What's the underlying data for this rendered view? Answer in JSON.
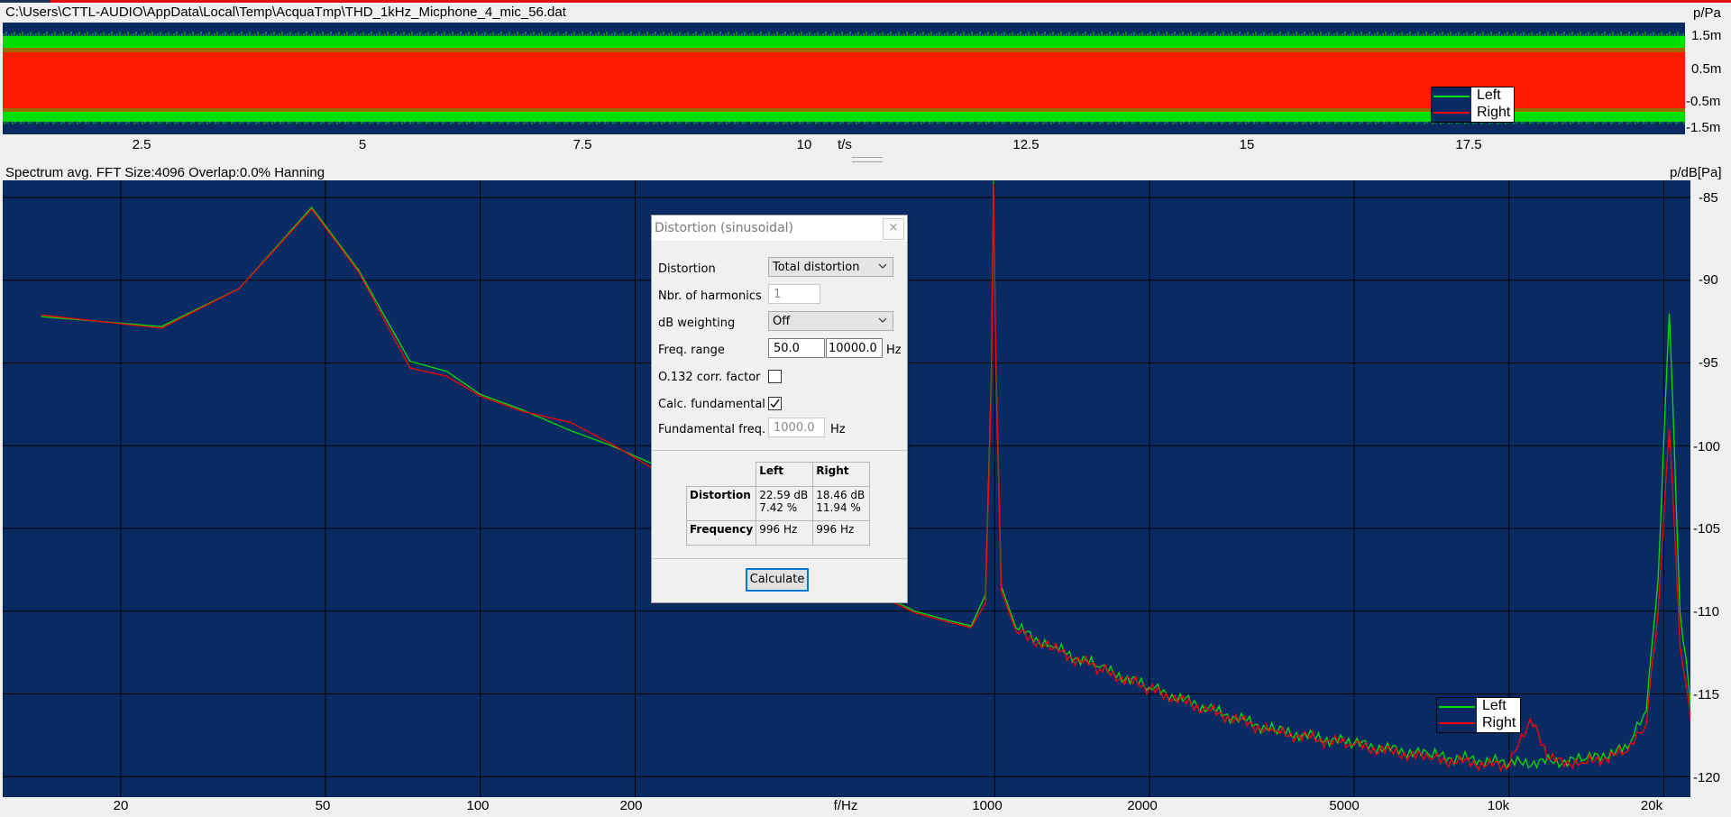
{
  "colors": {
    "plot_bg": "#0a2a63",
    "left": "#00e000",
    "right": "#ff0000",
    "grid": "#000000"
  },
  "waveform": {
    "file_path": "C:\\Users\\CTTL-AUDIO\\AppData\\Local\\Temp\\AcquaTmp\\THD_1kHz_Micphone_4_mic_56.dat",
    "y_unit": "p/Pa",
    "y_ticks": [
      "1.5m",
      "0.5m",
      "-0.5m",
      "-1.5m"
    ],
    "x_ticks": [
      "2.5",
      "5",
      "7.5",
      "10",
      "12.5",
      "15",
      "17.5"
    ],
    "x_unit": "t/s",
    "legend": [
      "Left",
      "Right"
    ]
  },
  "spectrum": {
    "info": "Spectrum avg.  FFT Size:4096  Overlap:0.0%  Hanning",
    "y_unit": "p/dB[Pa]",
    "y_ticks": [
      "-85",
      "-90",
      "-95",
      "-100",
      "-105",
      "-110",
      "-115",
      "-120"
    ],
    "x_ticks": [
      "20",
      "50",
      "100",
      "200",
      "1000",
      "2000",
      "5000",
      "10k",
      "20k"
    ],
    "x_unit": "f/Hz",
    "legend": [
      "Left",
      "Right"
    ]
  },
  "chart_data": {
    "type": "line",
    "xlabel": "f/Hz",
    "ylabel": "p/dB[Pa]",
    "x_scale": "log",
    "ylim": [
      -121,
      -84
    ],
    "grid": true,
    "legend": "bottom-right",
    "series": [
      {
        "name": "Left",
        "x": [
          14,
          24,
          34,
          47,
          58,
          73,
          86,
          100,
          120,
          150,
          180,
          220,
          260,
          300,
          400,
          500,
          600,
          700,
          800,
          900,
          960,
          985,
          995,
          1005,
          1030,
          1100,
          1300,
          1600,
          2000,
          2600,
          3500,
          5000,
          7000,
          10000,
          14000,
          17000,
          18500,
          19500,
          20500,
          21500,
          23000,
          25000
        ],
        "y": [
          -92.2,
          -92.8,
          -90.5,
          -85.6,
          -89.4,
          -94.9,
          -95.5,
          -96.9,
          -97.8,
          -99.1,
          -100.0,
          -101.2,
          -102.5,
          -103.5,
          -105.7,
          -107.5,
          -109.0,
          -110.0,
          -110.5,
          -110.9,
          -109.0,
          -96.0,
          -84.0,
          -95.0,
          -108.5,
          -111.0,
          -112.2,
          -113.4,
          -114.6,
          -115.9,
          -117.2,
          -118.0,
          -118.7,
          -119.2,
          -119.0,
          -118.3,
          -116.0,
          -108.0,
          -92.0,
          -110.0,
          -118.0,
          -119.7
        ]
      },
      {
        "name": "Right",
        "x": [
          14,
          24,
          34,
          47,
          58,
          73,
          86,
          100,
          120,
          150,
          180,
          220,
          260,
          300,
          400,
          500,
          600,
          700,
          800,
          900,
          960,
          985,
          995,
          1005,
          1030,
          1100,
          1300,
          1600,
          2000,
          2600,
          3500,
          5000,
          7000,
          10000,
          11000,
          12000,
          14000,
          17000,
          18500,
          19500,
          20500,
          21500,
          23000,
          25000
        ],
        "y": [
          -92.1,
          -92.9,
          -90.5,
          -85.7,
          -89.5,
          -95.3,
          -95.8,
          -97.0,
          -97.9,
          -98.6,
          -99.9,
          -101.5,
          -102.7,
          -103.6,
          -105.8,
          -107.6,
          -109.1,
          -110.1,
          -110.6,
          -111.0,
          -109.5,
          -96.5,
          -84.2,
          -94.5,
          -108.8,
          -111.2,
          -112.3,
          -113.5,
          -114.7,
          -116.0,
          -117.3,
          -118.1,
          -118.9,
          -119.4,
          -116.5,
          -119.0,
          -119.2,
          -118.5,
          -116.8,
          -110.0,
          -99.0,
          -112.0,
          -118.5,
          -120.2
        ]
      }
    ]
  },
  "dialog": {
    "title": "Distortion (sinusoidal)",
    "close_symbol": "×",
    "distortion_label": "Distortion",
    "distortion_value": "Total distortion",
    "harmonics_label": "Nbr. of harmonics",
    "harmonics_value": "1",
    "weighting_label": "dB weighting",
    "weighting_value": "Off",
    "freq_range_label": "Freq. range",
    "freq_min": "50.0",
    "freq_max": "10000.0",
    "freq_unit": "Hz",
    "o132_label": "O.132 corr. factor",
    "o132_checked": false,
    "calc_fund_label": "Calc. fundamental",
    "calc_fund_checked": true,
    "fund_freq_label": "Fundamental freq.",
    "fund_freq_value": "1000.0",
    "fund_freq_unit": "Hz",
    "table": {
      "col_left": "Left",
      "col_right": "Right",
      "row_distortion": "Distortion",
      "dist_left_db": "22.59 dB",
      "dist_left_pct": "7.42 %",
      "dist_right_db": "18.46 dB",
      "dist_right_pct": "11.94 %",
      "row_frequency": "Frequency",
      "freq_left": "996 Hz",
      "freq_right": "996 Hz"
    },
    "calculate_label": "Calculate"
  }
}
